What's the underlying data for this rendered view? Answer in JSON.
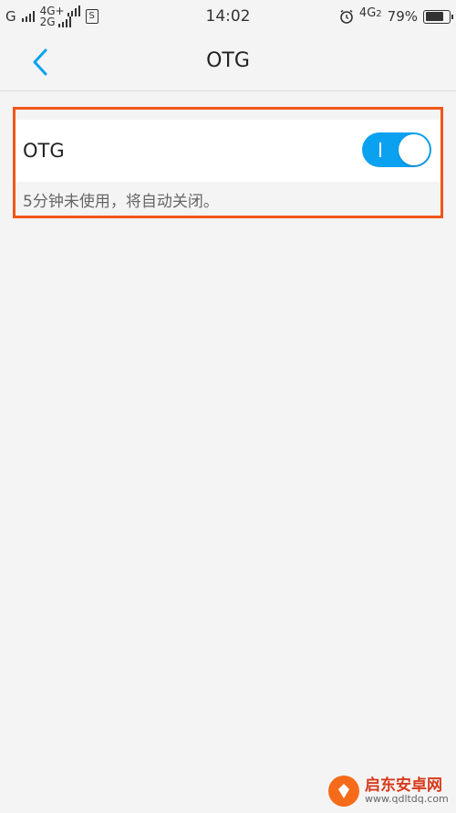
{
  "status_bar": {
    "carrier1": "G",
    "net1": "4G+",
    "net2": "2G",
    "sim_label": "S",
    "time": "14:02",
    "net3": "4G",
    "net3_sub": "2",
    "battery": "79%",
    "battery_level": 0.79
  },
  "header": {
    "title": "OTG"
  },
  "otg_setting": {
    "label": "OTG",
    "enabled": true,
    "description": "5分钟未使用，将自动关闭。"
  },
  "colors": {
    "accent": "#0aa1f0",
    "highlight": "#f0561a",
    "background": "#f4f4f4"
  },
  "watermark": {
    "title": "启东安卓网",
    "url": "www.qdltdq.com"
  }
}
